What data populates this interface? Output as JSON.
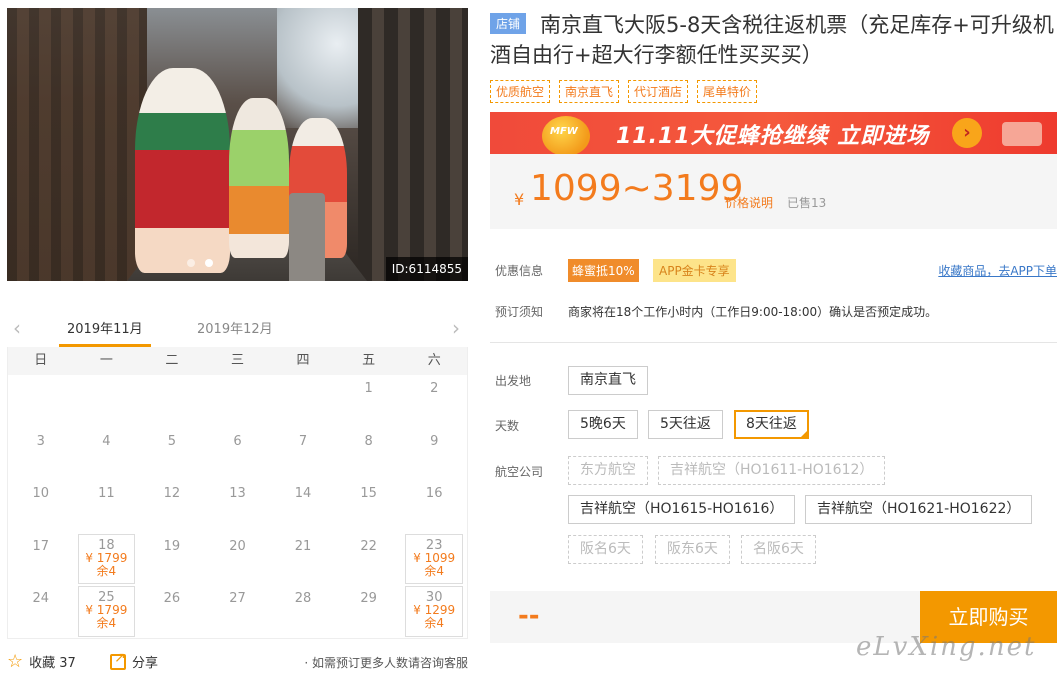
{
  "gallery": {
    "id_label": "ID:6114855",
    "slides": 2,
    "active_slide": 2
  },
  "calendar": {
    "prev_icon": "chevron-left-icon",
    "next_icon": "chevron-right-icon",
    "months": [
      "2019年11月",
      "2019年12月"
    ],
    "weekdays": [
      "日",
      "一",
      "二",
      "三",
      "四",
      "五",
      "六"
    ],
    "days": [
      {
        "d": ""
      },
      {
        "d": ""
      },
      {
        "d": ""
      },
      {
        "d": ""
      },
      {
        "d": ""
      },
      {
        "d": "1"
      },
      {
        "d": "2"
      },
      {
        "d": "3"
      },
      {
        "d": "4"
      },
      {
        "d": "5"
      },
      {
        "d": "6"
      },
      {
        "d": "7"
      },
      {
        "d": "8"
      },
      {
        "d": "9"
      },
      {
        "d": "10"
      },
      {
        "d": "11"
      },
      {
        "d": "12"
      },
      {
        "d": "13"
      },
      {
        "d": "14"
      },
      {
        "d": "15"
      },
      {
        "d": "16"
      },
      {
        "d": "17"
      },
      {
        "d": "18",
        "price": "¥ 1799",
        "stock": "余4"
      },
      {
        "d": "19"
      },
      {
        "d": "20"
      },
      {
        "d": "21"
      },
      {
        "d": "22"
      },
      {
        "d": "23",
        "price": "¥ 1099",
        "stock": "余4"
      },
      {
        "d": "24"
      },
      {
        "d": "25",
        "price": "¥ 1799",
        "stock": "余4"
      },
      {
        "d": "26"
      },
      {
        "d": "27"
      },
      {
        "d": "28"
      },
      {
        "d": "29"
      },
      {
        "d": "30",
        "price": "¥ 1299",
        "stock": "余4"
      }
    ]
  },
  "bottom": {
    "fav_label": "收藏 37",
    "share_label": "分享",
    "note": "· 如需预订更多人数请咨询客服"
  },
  "product": {
    "shop_tag": "店铺",
    "title": "南京直飞大阪5-8天含税往返机票（充足库存+可升级机酒自由行+超大行李额任性买买买）",
    "tags": [
      "优质航空",
      "南京直飞",
      "代订酒店",
      "尾单特价"
    ]
  },
  "banner": {
    "logo_text": "MFW",
    "text": "11.11大促蜂抢继续 立即进场",
    "go_symbol": "›"
  },
  "price": {
    "currency": "¥",
    "range": "1099~3199",
    "explain": "价格说明",
    "sold": "已售13"
  },
  "promo": {
    "label": "优惠信息",
    "badge1": "蜂蜜抵10%",
    "badge2": "APP金卡专享",
    "fav_link": "收藏商品，去APP下单"
  },
  "notice": {
    "label": "预订须知",
    "text": "商家将在18个工作小时内（工作日9:00-18:00）确认是否预定成功。"
  },
  "options": {
    "departure_label": "出发地",
    "departure": [
      "南京直飞"
    ],
    "days_label": "天数",
    "days": [
      "5晚6天",
      "5天往返",
      "8天往返"
    ],
    "days_selected": "8天往返",
    "airline_label": "航空公司",
    "airlines": [
      "东方航空",
      "吉祥航空（HO1611-HO1612）",
      "吉祥航空（HO1615-HO1616）",
      "吉祥航空（HO1621-HO1622）"
    ],
    "routes": [
      "阪名6天",
      "阪东6天",
      "名阪6天"
    ]
  },
  "buy": {
    "total": "--",
    "button": "立即购买"
  },
  "watermark": "eLvXing.net"
}
